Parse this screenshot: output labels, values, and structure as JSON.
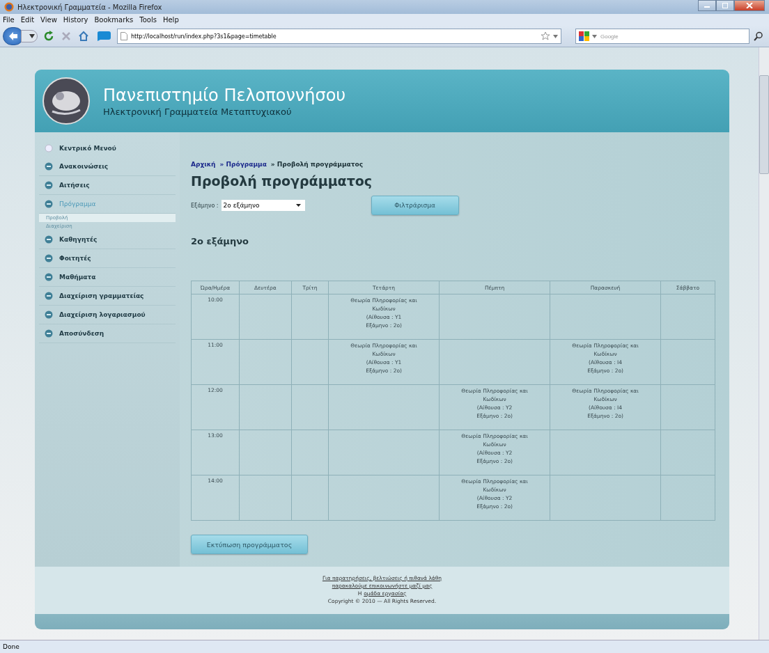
{
  "window": {
    "title": "Ηλεκτρονική Γραμματεία - Mozilla Firefox"
  },
  "menu": [
    "File",
    "Edit",
    "View",
    "History",
    "Bookmarks",
    "Tools",
    "Help"
  ],
  "address_bar": {
    "value": "http://localhost/run/index.php?3s1&page=timetable"
  },
  "search_bar": {
    "placeholder": "Google"
  },
  "site": {
    "title": "Πανεπιστημίο Πελοποννήσου",
    "subtitle": "Ηλεκτρονική Γραμματεία Μεταπτυχιακού"
  },
  "sidebar": {
    "items": [
      {
        "label": "Κεντρικό Μενού",
        "kind": "home",
        "selected": false
      },
      {
        "label": "Ανακοινώσεις",
        "kind": "item",
        "selected": false
      },
      {
        "label": "Αιτήσεις",
        "kind": "item",
        "selected": false
      },
      {
        "label": "Πρόγραμμα",
        "kind": "item",
        "selected": true,
        "children": [
          {
            "label": "Προβολή",
            "selected": true
          },
          {
            "label": "Διαχείριση",
            "selected": false
          }
        ]
      },
      {
        "label": "Καθηγητές",
        "kind": "item",
        "selected": false
      },
      {
        "label": "Φοιτητές",
        "kind": "item",
        "selected": false
      },
      {
        "label": "Μαθήματα",
        "kind": "item",
        "selected": false
      },
      {
        "label": "Διαχείριση γραμματείας",
        "kind": "item",
        "selected": false
      },
      {
        "label": "Διαχείριση λογαριασμού",
        "kind": "item",
        "selected": false
      },
      {
        "label": "Αποσύνδεση",
        "kind": "item",
        "selected": false
      }
    ]
  },
  "breadcrumb": [
    {
      "label": "Αρχική",
      "link": true
    },
    {
      "label": "» Πρόγραμμα",
      "link": true
    },
    {
      "label": "» Προβολή προγράμματος",
      "link": false
    }
  ],
  "heading": "Προβολή προγράμματος",
  "filter": {
    "label": "Εξάμηνο :",
    "value": "2ο εξάμηνο",
    "button": "Φιλτράρισμα"
  },
  "subheading": "2ο εξάμηνο",
  "table": {
    "columns": [
      "Ώρα/Ημέρα",
      "Δευτέρα",
      "Τρίτη",
      "Τετάρτη",
      "Πέμπτη",
      "Παρασκευή",
      "Σάββατο"
    ],
    "rows": [
      {
        "cells": [
          "10:00",
          "",
          "",
          {
            "course": "Θεωρία Πληροφορίας και Κωδίκων",
            "room": "(Αίθουσα : Υ1",
            "semester": "Εξάμηνο : 2ο)"
          },
          "",
          "",
          ""
        ]
      },
      {
        "cells": [
          "11:00",
          "",
          "",
          {
            "course": "Θεωρία Πληροφορίας και Κωδίκων",
            "room": "(Αίθουσα : Υ1",
            "semester": "Εξάμηνο : 2ο)"
          },
          "",
          {
            "course": "Θεωρία Πληροφορίας και Κωδίκων",
            "room": "(Αίθουσα : Ι4",
            "semester": "Εξάμηνο : 2ο)"
          },
          ""
        ]
      },
      {
        "cells": [
          "12:00",
          "",
          "",
          "",
          {
            "course": "Θεωρία Πληροφορίας και Κωδίκων",
            "room": "(Αίθουσα : Υ2",
            "semester": "Εξάμηνο : 2ο)"
          },
          {
            "course": "Θεωρία Πληροφορίας και Κωδίκων",
            "room": "(Αίθουσα : Ι4",
            "semester": "Εξάμηνο : 2ο)"
          },
          ""
        ]
      },
      {
        "cells": [
          "13:00",
          "",
          "",
          "",
          {
            "course": "Θεωρία Πληροφορίας και Κωδίκων",
            "room": "(Αίθουσα : Υ2",
            "semester": "Εξάμηνο : 2ο)"
          },
          "",
          ""
        ]
      },
      {
        "cells": [
          "14:00",
          "",
          "",
          "",
          {
            "course": "Θεωρία Πληροφορίας και Κωδίκων",
            "room": "(Αίθουσα : Υ2",
            "semester": "Εξάμηνο : 2ο)"
          },
          "",
          ""
        ]
      }
    ]
  },
  "print_button": "Εκτύπωση προγράμματος",
  "footer": {
    "lines": [
      {
        "text": "Για παρατηρήσεις, βελτιώσεις ή πιθανά λάθη",
        "link": true
      },
      {
        "text": "παρακαλούμε επικοινωνήστε μαζί μας",
        "link": true
      },
      {
        "prefix": "Η",
        "text": "ομάδα εργασίας",
        "link": true
      },
      {
        "text": "Copyright © 2010 — All Rights Reserved.",
        "link": false
      }
    ]
  },
  "status_bar": "Done"
}
